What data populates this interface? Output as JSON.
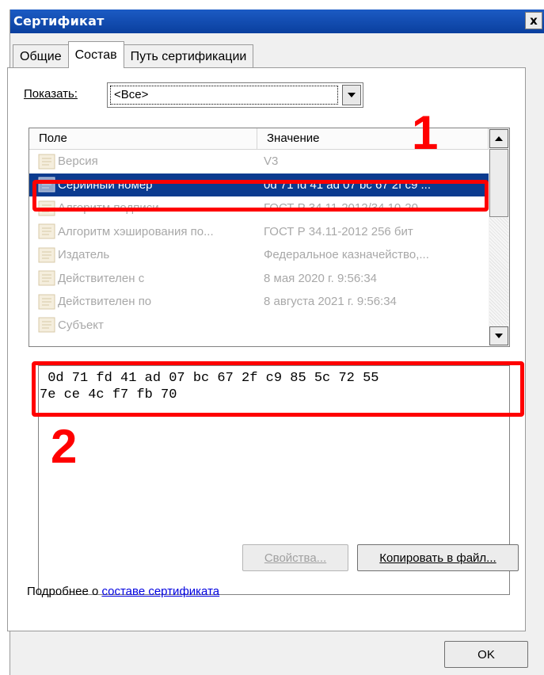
{
  "window": {
    "title": "Сертификат",
    "close_glyph": "x"
  },
  "tabs": [
    {
      "label": "Общие"
    },
    {
      "label": "Состав"
    },
    {
      "label": "Путь сертификации"
    }
  ],
  "show": {
    "label": "Показать:",
    "selected": "<Все>"
  },
  "list": {
    "columns": [
      "Поле",
      "Значение"
    ],
    "rows": [
      {
        "field": "Версия",
        "value": "V3"
      },
      {
        "field": "Серийный номер",
        "value": "0d 71 fd 41 ad 07 bc 67 2f c9 ..."
      },
      {
        "field": "Алгоритм подписи",
        "value": "ГОСТ Р 34.11-2012/34.10-20..."
      },
      {
        "field": "Алгоритм хэширования по...",
        "value": "ГОСТ Р 34.11-2012 256 бит"
      },
      {
        "field": "Издатель",
        "value": "Федеральное казначейство,..."
      },
      {
        "field": "Действителен с",
        "value": "8 мая 2020 г. 9:56:34"
      },
      {
        "field": "Действителен по",
        "value": "8 августа 2021 г. 9:56:34"
      },
      {
        "field": "Субъект",
        "value": ""
      }
    ]
  },
  "detail": {
    "line1": " 0d 71 fd 41 ad 07 bc 67 2f c9 85 5c 72 55",
    "line2": "7e ce 4c f7 fb 70"
  },
  "annotations": {
    "marker1": "1",
    "marker2": "2",
    "color": "#ff0000"
  },
  "buttons": {
    "properties": "Свойства...",
    "copy_to_file": "Копировать в файл...",
    "ok": "OK"
  },
  "more_info": {
    "prefix": "Подробнее о ",
    "link": "составе сертификата"
  },
  "colors": {
    "title_bar": "#0a3f9e",
    "selection": "#0b3b8f",
    "link": "#0000e0"
  }
}
